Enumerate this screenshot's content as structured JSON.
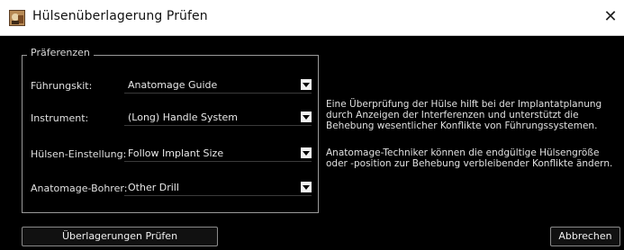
{
  "window": {
    "title": "Hülsenüberlagerung Prüfen",
    "close_symbol": "✕",
    "app_icon": "anatomage-app-icon"
  },
  "preferences": {
    "group_title": "Präferenzen",
    "rows": [
      {
        "label": "Führungskit:",
        "value": "Anatomage  Guide"
      },
      {
        "label": "Instrument:",
        "value": "(Long)  Handle  System"
      },
      {
        "label": "Hülsen-Einstellung:",
        "value": "Follow  Implant  Size"
      },
      {
        "label": "Anatomage-Bohrer:",
        "value": "Other  Drill"
      }
    ]
  },
  "info": {
    "paragraph1": "Eine Überprüfung der Hülse hilft bei der Implantatplanung durch Anzeigen der Interferenzen und unterstützt die Behebung wesentlicher Konflikte von Führungssystemen.",
    "paragraph2": "Anatomage-Techniker können die endgültige Hülsengröße oder -position zur Behebung verbleibender Konflikte ändern."
  },
  "buttons": {
    "check_overlaps": "Überlagerungen Prüfen",
    "cancel": "Abbrechen"
  },
  "colors": {
    "background": "#000000",
    "titlebar": "#ffffff",
    "text": "#e6e6e6",
    "dropdown_arrow_bg": "#f2f2f2"
  }
}
